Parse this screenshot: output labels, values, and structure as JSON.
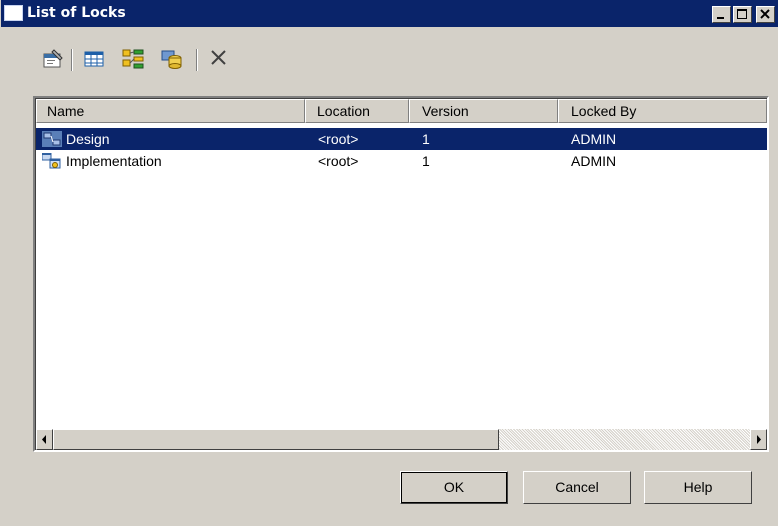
{
  "window": {
    "title": "List of Locks",
    "controls": [
      "minimize-icon",
      "maximize-icon",
      "close-icon"
    ]
  },
  "toolbar": {
    "tools": [
      "properties-icon",
      "table-columns-icon",
      "tree-view-icon",
      "database-icon",
      "delete-icon"
    ]
  },
  "list": {
    "columns": [
      "Name",
      "Location",
      "Version",
      "Locked By"
    ],
    "rows": [
      {
        "name": "Design",
        "location": "<root>",
        "version": "1",
        "locked_by": "ADMIN",
        "selected": true,
        "icon": "design-model-icon"
      },
      {
        "name": "Implementation",
        "location": "<root>",
        "version": "1",
        "locked_by": "ADMIN",
        "selected": false,
        "icon": "implementation-model-icon"
      }
    ]
  },
  "buttons": {
    "ok": "OK",
    "cancel": "Cancel",
    "help": "Help"
  },
  "colors": {
    "titlebar": "#0a246a",
    "dialog": "#d4d0c8",
    "selection": "#0a246a"
  }
}
